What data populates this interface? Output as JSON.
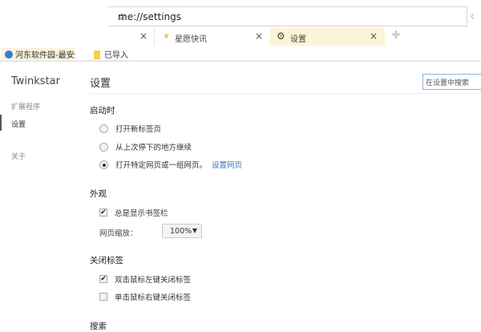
{
  "toolbar": {
    "url": "me://settings"
  },
  "tabs": [
    {
      "label": ""
    },
    {
      "label": "星愿快讯"
    },
    {
      "label": "设置"
    }
  ],
  "bookmarks": [
    {
      "label": "河东软件园-最安全的"
    },
    {
      "label": "已导入"
    }
  ],
  "sidebar": {
    "brand": "Twinkstar",
    "items": [
      {
        "label": "扩展程序"
      },
      {
        "label": "设置"
      },
      {
        "label": "关于"
      }
    ]
  },
  "main": {
    "title": "设置",
    "search_placeholder": "在设置中搜索",
    "startup": {
      "heading": "启动时",
      "options": [
        "打开新标签页",
        "从上次停下的地方继续",
        "打开特定网页或一组网页。"
      ],
      "link": "设置网页",
      "selected": 2
    },
    "appearance": {
      "heading": "外观",
      "show_bookmarks": "总是显示书签栏",
      "zoom_label": "网页缩放：",
      "zoom_value": "100%"
    },
    "close_tab": {
      "heading": "关闭标签",
      "options": [
        "双击鼠标左键关闭标签",
        "单击鼠标右键关闭标签"
      ]
    },
    "search": {
      "heading": "搜索"
    }
  }
}
